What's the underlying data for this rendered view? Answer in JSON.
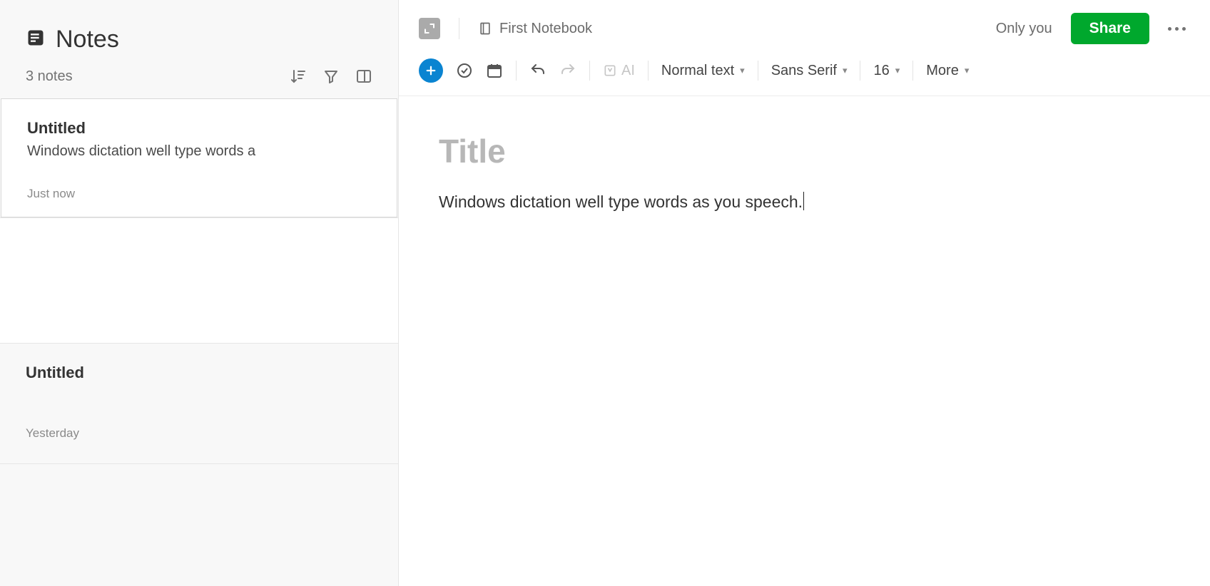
{
  "sidebar": {
    "title": "Notes",
    "count_label": "3 notes",
    "notes": [
      {
        "title": "Untitled",
        "preview": "Windows dictation well type words a",
        "time": "Just now"
      },
      {
        "title": "Untitled",
        "preview": "",
        "time": "Yesterday"
      }
    ]
  },
  "topbar": {
    "notebook": "First Notebook",
    "only_you": "Only you",
    "share": "Share"
  },
  "toolbar": {
    "ai": "AI",
    "text_style": "Normal text",
    "font": "Sans Serif",
    "font_size": "16",
    "more": "More"
  },
  "editor": {
    "title_placeholder": "Title",
    "body": "Windows dictation well type words as you speech."
  }
}
